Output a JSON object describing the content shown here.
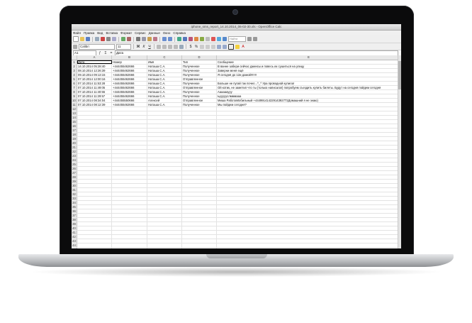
{
  "window": {
    "title": "iphone_sms_report_14.10.2014_06-02-30.xls - OpenOffice Calc"
  },
  "menu": [
    "Файл",
    "Правка",
    "Вид",
    "Вставка",
    "Формат",
    "Сервис",
    "Данные",
    "Окно",
    "Справка"
  ],
  "toolbar": {
    "search_placeholder": "Найти"
  },
  "format": {
    "font_name": "Calibri",
    "font_size": "11"
  },
  "formula": {
    "cell_ref": "A1",
    "content": "Дата"
  },
  "columns": [
    "A",
    "B",
    "C",
    "D",
    "E"
  ],
  "rows": [
    [
      "1",
      "Дата",
      "Номер",
      "Имя",
      "Тип",
      "Сообщение"
    ],
    [
      "2",
      "14.10.2014 05:28:40",
      "+444455462666",
      "Наташа С.А.",
      "Полученное",
      "В ванне забери сейчас джинсы и повесь их сушиться на улицу"
    ],
    [
      "3",
      "08.10.2014 12:26:39",
      "+444455462666",
      "Наташа С.А.",
      "Полученное",
      "Заверни меня ещё"
    ],
    [
      "4",
      "09.10.2014 09:13:15",
      "+444455462666",
      "Наташа С.А.",
      "Полученное",
      "Я сегодня до 12и домой!!!!!!!"
    ],
    [
      "5",
      "07.10.2014 12:00:16",
      "+444455462666",
      "Наташа С.А.",
      "Отправленное",
      ""
    ],
    [
      "6",
      "07.10.2014 11:53:28",
      "+444455462666",
      "Наташа С.А.",
      "Полученное",
      "Больше не пугай так почел...^_^ Ура проводной купила!"
    ],
    [
      "7",
      "07.10.2014 11:49:05",
      "+444455462666",
      "Наташа С.А.",
      "Отправленное",
      "Ой котик, не заметил что ты (только написала!) попробуем съездить купить билеты. Будут на сегодня пойдем сегодня"
    ],
    [
      "8",
      "07.10.2014 11:40:55",
      "+444455462666",
      "Наташа С.А.",
      "Полученное",
      "Ааааааууу"
    ],
    [
      "9",
      "07.10.2014 11:29:57",
      "+444455462666",
      "Наташа С.А.",
      "Полученное",
      "Ьуууууслмммааа"
    ],
    [
      "10",
      "07.10.2014 08:34:04",
      "+444455550666",
      "Алексей",
      "Отправленное",
      "Миша РаботаМобильный +44499141422914392772Домашний я не знаю)"
    ],
    [
      "11",
      "07.10.2014 08:12:39",
      "+444455462666",
      "Наташа С.А.",
      "Полученное",
      "Мы пойдем сегодня?"
    ]
  ],
  "empty_row_numbers": [
    "12",
    "13",
    "14",
    "15",
    "16",
    "17",
    "18",
    "19",
    "20",
    "21",
    "22",
    "23",
    "24",
    "25",
    "26",
    "27",
    "28",
    "29",
    "30",
    "31",
    "32",
    "33",
    "34",
    "35",
    "36",
    "37",
    "38",
    "39",
    "40",
    "41",
    "42",
    "43",
    "44",
    "45"
  ]
}
